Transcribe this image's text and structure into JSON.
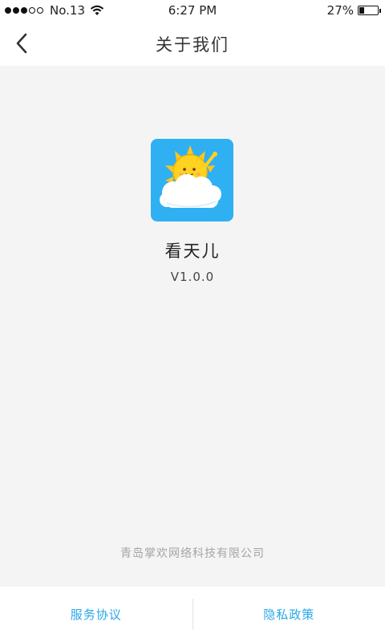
{
  "status_bar": {
    "carrier": "No.13",
    "time": "6:27 PM",
    "battery_text": "27%",
    "battery_level": 0.27,
    "signal_bars_filled": 3,
    "signal_bars_total": 5
  },
  "nav": {
    "title": "关于我们",
    "back_icon": "chevron-left-icon"
  },
  "app": {
    "name": "看天儿",
    "version": "V1.0.0",
    "icon": "sun-cloud-logo",
    "icon_bg_color": "#2fb0f3"
  },
  "company": "青岛掌欢网络科技有限公司",
  "footer": {
    "service_agreement": "服务协议",
    "privacy_policy": "隐私政策",
    "link_color": "#29a8e8"
  }
}
